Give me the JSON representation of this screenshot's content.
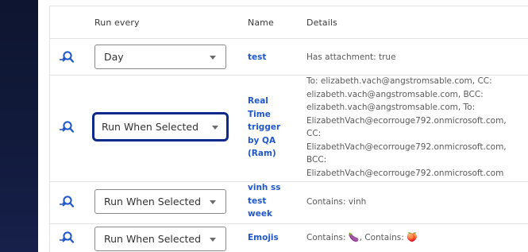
{
  "table": {
    "headers": {
      "run_every": "Run every",
      "name": "Name",
      "details": "Details"
    },
    "rows": [
      {
        "run_every": "Day",
        "name": "test",
        "details": "Has attachment: true",
        "focused": false
      },
      {
        "run_every": "Run When Selected",
        "name": "Real\nTime\ntrigger\nby QA\n(Ram)",
        "details": "To: elizabeth.vach@angstromsable.com, CC:\nelizabeth.vach@angstromsable.com, BCC:\nelizabeth.vach@angstromsable.com, To:\nElizabethVach@ecorrouge792.onmicrosoft.com,\nCC:\nElizabethVach@ecorrouge792.onmicrosoft.com,\nBCC:\nElizabethVach@ecorrouge792.onmicrosoft.com",
        "focused": true
      },
      {
        "run_every": "Run When Selected",
        "name": "vinh ss\ntest\nweek",
        "details": "Contains: vinh",
        "focused": false
      },
      {
        "run_every": "Run When Selected",
        "name": "Emojis",
        "details_prefix": "Contains: ",
        "details_emoji1": "🍆",
        "details_mid": ", Contains: ",
        "details_emoji2": "🍑",
        "focused": false
      }
    ]
  },
  "colors": {
    "link": "#2158c9",
    "focus_ring": "#0d2a8a",
    "sidebar": "#111a3a"
  },
  "icons": {
    "run_rule": "search-run-icon"
  }
}
